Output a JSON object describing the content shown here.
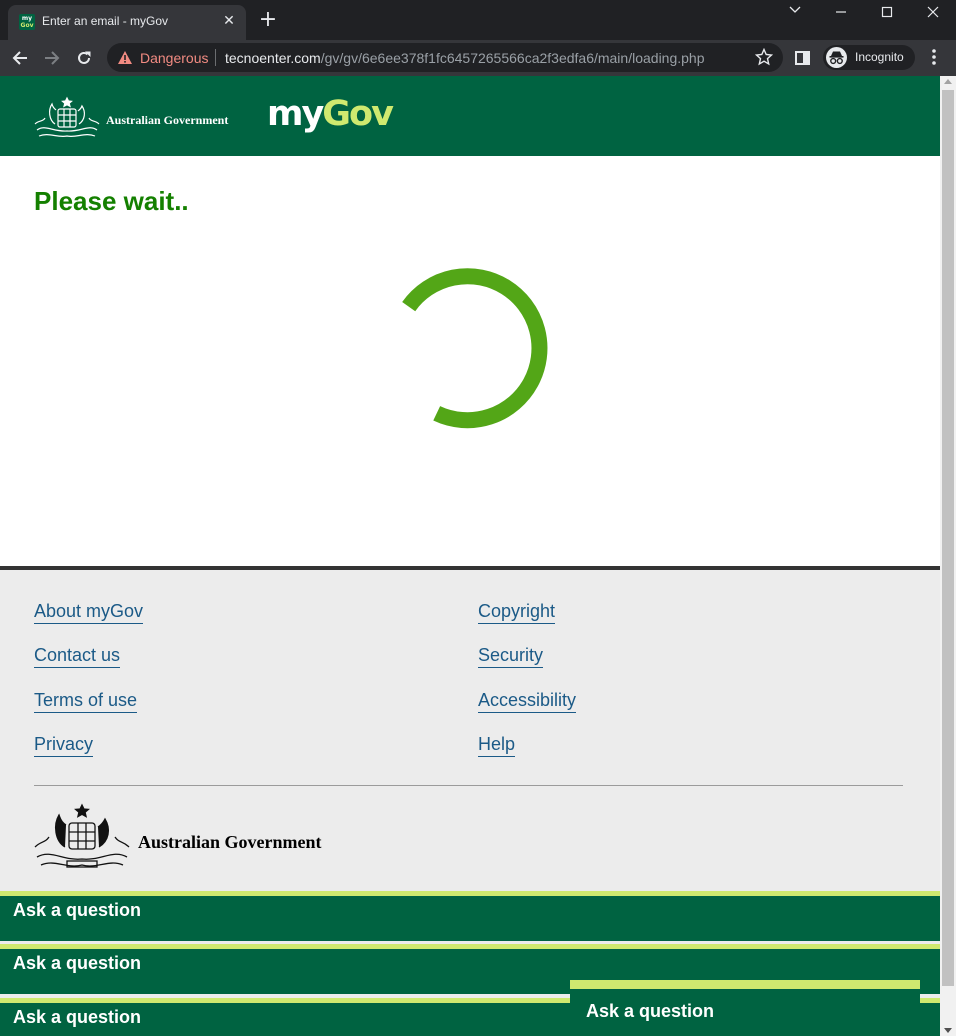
{
  "browser": {
    "tab_title": "Enter an email - myGov",
    "tab_favicon_top": "my",
    "tab_favicon_bottom": "Gov",
    "tab_close": "✕",
    "new_tab": "+",
    "security_label": "Dangerous",
    "url_host": "tecnoenter.com",
    "url_path": "/gv/gv/6e6ee378f1fc6457265566ca2f3edfa6/main/loading.php",
    "profile_label": "Incognito"
  },
  "header": {
    "gov_name": "Australian Government",
    "logo_my": "my",
    "logo_gov": "Gov"
  },
  "main": {
    "title": "Please wait.."
  },
  "footer": {
    "links_left": [
      "About myGov",
      "Contact us",
      "Terms of use",
      "Privacy"
    ],
    "links_right": [
      "Copyright",
      "Security",
      "Accessibility",
      "Help"
    ],
    "gov_name": "Australian Government"
  },
  "ask_bars": [
    "Ask a question",
    "Ask a question",
    "Ask a question"
  ],
  "ask_float": "Ask a question",
  "colors": {
    "brand_green": "#006341",
    "accent_lime": "#cfe96f",
    "spinner_green": "#53a617",
    "title_green": "#148000",
    "link_blue": "#1b5a87",
    "danger_red": "#f28b82"
  }
}
